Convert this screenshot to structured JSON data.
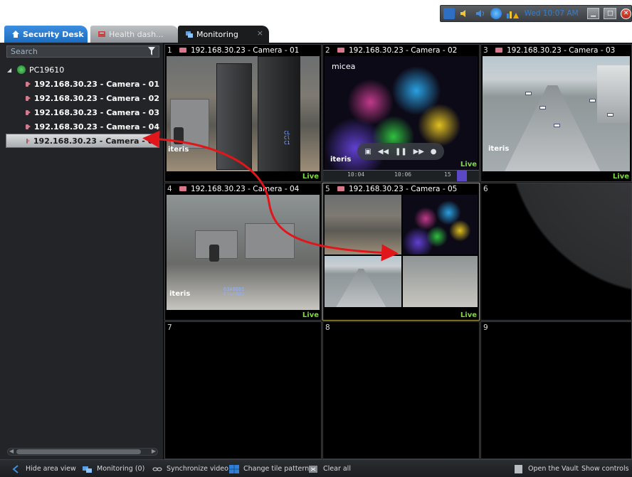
{
  "tray": {
    "time": "Wed 10:07 AM",
    "icons": [
      "network-icon",
      "speaker-icon",
      "volume-icon",
      "globe-icon",
      "warning-chart-icon"
    ],
    "window_buttons": [
      "minimize-icon",
      "maximize-icon",
      "close-icon"
    ]
  },
  "tabs": [
    {
      "label": "Security Desk",
      "icon": "home-icon",
      "active": false
    },
    {
      "label": "Health dash...",
      "icon": "health-dashboard-icon",
      "active": false
    },
    {
      "label": "Monitoring",
      "icon": "monitoring-icon",
      "active": true,
      "close": "×"
    }
  ],
  "sidebar": {
    "search_placeholder": "Search",
    "root": "PC19610",
    "items": [
      {
        "label": "192.168.30.23 - Camera - 01",
        "selected": false
      },
      {
        "label": "192.168.30.23 - Camera - 02",
        "selected": false
      },
      {
        "label": "192.168.30.23 - Camera - 03",
        "selected": false
      },
      {
        "label": "192.168.30.23 - Camera - 04",
        "selected": false
      },
      {
        "label": "192.168.30.23 - Camera - 05",
        "selected": true
      }
    ]
  },
  "tiles": [
    {
      "number": "1",
      "title": "192.168.30.23 - Camera - 01",
      "status": "Live"
    },
    {
      "number": "2",
      "title": "192.168.30.23 - Camera - 02",
      "status": "Live"
    },
    {
      "number": "3",
      "title": "192.168.30.23 - Camera - 03",
      "status": "Live"
    },
    {
      "number": "4",
      "title": "192.168.30.23 - Camera - 04",
      "status": "Live"
    },
    {
      "number": "5",
      "title": "192.168.30.23 - Camera - 05",
      "status": "Live"
    },
    {
      "number": "6",
      "title": "",
      "status": ""
    },
    {
      "number": "7",
      "title": "",
      "status": ""
    },
    {
      "number": "8",
      "title": "",
      "status": ""
    },
    {
      "number": "9",
      "title": "",
      "status": ""
    }
  ],
  "overlays": {
    "iteris": "iteris",
    "micea": "micea",
    "timeline_labels": [
      "10:04",
      "10:06",
      "15"
    ]
  },
  "bottombar": {
    "hide_area_view": "Hide area view",
    "monitoring": "Monitoring (0)",
    "synchronize_video": "Synchronize video",
    "change_tile_pattern": "Change tile pattern",
    "clear_all": "Clear all",
    "open_vault": "Open the Vault",
    "show_controls": "Show controls"
  },
  "colors": {
    "accent": "#1d6cc0",
    "live": "#7fd648",
    "drag_arrow": "#e0161b",
    "selected_tile_border": "#b5a43a"
  }
}
